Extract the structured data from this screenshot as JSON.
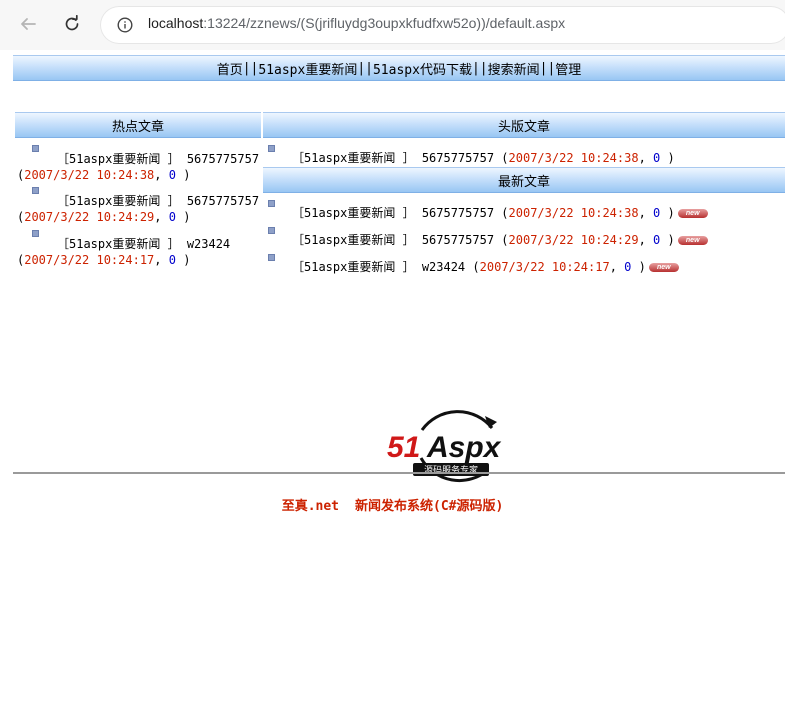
{
  "browser": {
    "url_host": "localhost",
    "url_rest": ":13224/zznews/(S(jrifluydg3oupxkfudfxw52o))/default.aspx"
  },
  "menu": {
    "items": [
      "首页",
      "51aspx重要新闻",
      "51aspx代码下载",
      "搜索新闻",
      "管理"
    ],
    "separator": "||"
  },
  "sections": {
    "hot": "热点文章",
    "headline": "头版文章",
    "latest": "最新文章"
  },
  "hot_articles": [
    {
      "category": "［51aspx重要新闻 ］",
      "title": "5675775757",
      "date": "2007/3/22 10:24:38",
      "count": "0"
    },
    {
      "category": "［51aspx重要新闻 ］",
      "title": "5675775757",
      "date": "2007/3/22 10:24:29",
      "count": "0"
    },
    {
      "category": "［51aspx重要新闻 ］",
      "title": "w23424",
      "date": "2007/3/22 10:24:17",
      "count": "0"
    }
  ],
  "headline_articles": [
    {
      "category": "［51aspx重要新闻 ］",
      "title": "5675775757",
      "date": "2007/3/22 10:24:38",
      "count": "0"
    }
  ],
  "latest_articles": [
    {
      "category": "［51aspx重要新闻 ］",
      "title": "5675775757",
      "date": "2007/3/22 10:24:38",
      "count": "0",
      "badge": "new"
    },
    {
      "category": "［51aspx重要新闻 ］",
      "title": "5675775757",
      "date": "2007/3/22 10:24:29",
      "count": "0",
      "badge": "new"
    },
    {
      "category": "［51aspx重要新闻 ］",
      "title": "w23424",
      "date": "2007/3/22 10:24:17",
      "count": "0",
      "badge": "new"
    }
  ],
  "punct": {
    "open": "(",
    "comma": ", ",
    "close": " )"
  },
  "logo": {
    "brand": "51Aspx",
    "tagline": "源码服务专家"
  },
  "footer": {
    "left": "至真.net",
    "right": "新闻发布系统(C#源码版)"
  },
  "colors": {
    "accent_red": "#cc2200",
    "count_blue": "#0000cc",
    "header_blue": "#98c6f3"
  }
}
